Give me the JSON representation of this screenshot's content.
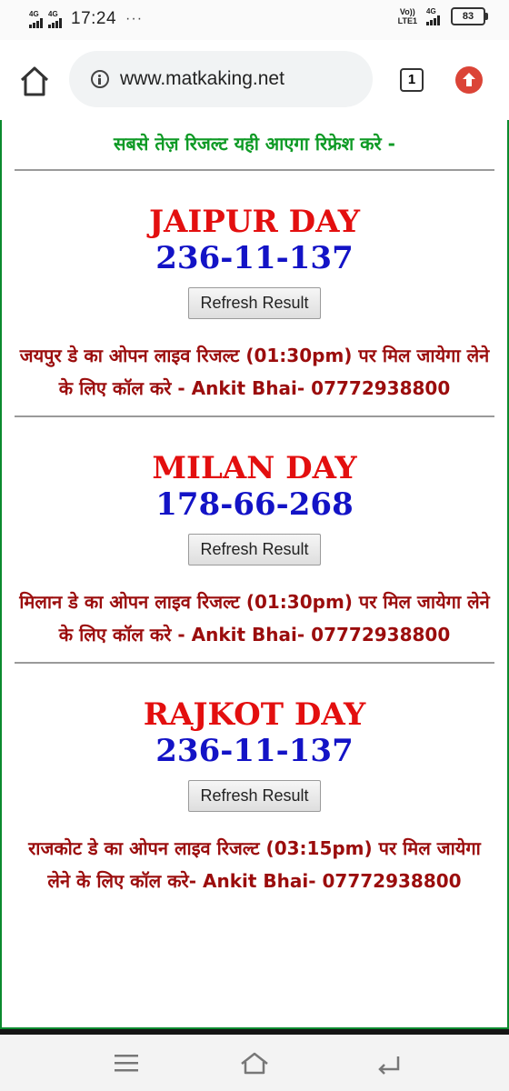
{
  "status_bar": {
    "sim1": "4G",
    "sim2": "4G",
    "time": "17:24",
    "overflow": "···",
    "volte_top": "Vo))",
    "volte_bottom": "LTE1",
    "net": "4G",
    "battery": "83"
  },
  "browser": {
    "url": "www.matkaking.net",
    "tab_count": "1",
    "home_icon": "home-icon",
    "update_icon": "update-arrow-icon"
  },
  "page": {
    "tagline": "सबसे तेज़ रिजल्ट यही आएगा रिफ्रेश करे -",
    "games": [
      {
        "name": "JAIPUR DAY",
        "result": "236-11-137",
        "button": "Refresh Result",
        "info": "जयपुर डे का ओपन लाइव रिजल्ट (01:30pm) पर मिल जायेगा लेने के लिए कॉल करे - Ankit Bhai- 07772938800"
      },
      {
        "name": "MILAN DAY",
        "result": "178-66-268",
        "button": "Refresh Result",
        "info": "मिलान डे का ओपन लाइव रिजल्ट (01:30pm) पर मिल जायेगा लेने के लिए कॉल करे - Ankit Bhai- 07772938800"
      },
      {
        "name": "RAJKOT DAY",
        "result": "236-11-137",
        "button": "Refresh Result",
        "info": "राजकोट डे का ओपन लाइव रिजल्ट (03:15pm) पर मिल जायेगा लेने के लिए कॉल करे- Ankit Bhai- 07772938800"
      }
    ]
  },
  "nav": {
    "menu_icon": "menu-icon",
    "home_icon": "home-icon",
    "back_icon": "back-icon"
  },
  "colors": {
    "game_title": "#e30f0f",
    "result": "#1313c6",
    "tagline": "#0e9a25",
    "info": "#9b0d0d",
    "page_border": "#0b8a2e"
  }
}
